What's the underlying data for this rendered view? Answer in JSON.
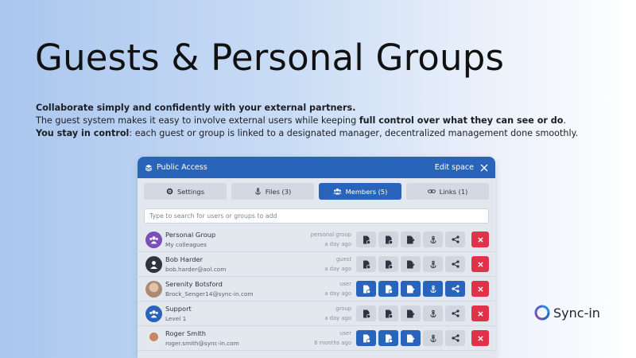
{
  "headline": "Guests & Personal Groups",
  "intro": {
    "line1": "Collaborate simply and confidently with your external partners.",
    "line2_a": "The guest system makes it easy to involve external users while keeping ",
    "line2_b": "full control over what they can see or do",
    "line2_c": ".",
    "line3_a": "You stay in control",
    "line3_b": ": each guest or group is linked to a designated manager, decentralized management done smoothly."
  },
  "panel": {
    "title": "Public Access",
    "edit_label": "Edit space",
    "tabs": [
      {
        "label": "Settings",
        "icon": "gear-icon"
      },
      {
        "label": "Files (3)",
        "icon": "anchor-icon"
      },
      {
        "label": "Members (5)",
        "icon": "users-icon",
        "active": true
      },
      {
        "label": "Links (1)",
        "icon": "link-icon"
      }
    ],
    "search_placeholder": "Type to search for users or groups to add",
    "members": [
      {
        "name": "Personal Group",
        "sub": "My colleagues",
        "type": "personal group",
        "time": "a day ago",
        "avatar": "group-avatar",
        "perms": [
          false,
          false,
          false,
          false,
          false
        ]
      },
      {
        "name": "Bob Harder",
        "sub": "bob.harder@aol.com",
        "type": "guest",
        "time": "a day ago",
        "avatar": "user-avatar",
        "perms": [
          false,
          false,
          false,
          false,
          false
        ]
      },
      {
        "name": "Serenity Botsford",
        "sub": "Brock_Senger14@sync-in.com",
        "type": "user",
        "time": "a day ago",
        "avatar": "photo-avatar",
        "perms": [
          true,
          true,
          true,
          true,
          true
        ]
      },
      {
        "name": "Support",
        "sub": "Level 1",
        "type": "group",
        "time": "a day ago",
        "avatar": "group-avatar",
        "perms": [
          false,
          false,
          false,
          false,
          false
        ]
      },
      {
        "name": "Roger Smith",
        "sub": "roger.smith@sync-in.com",
        "type": "user",
        "time": "8 months ago",
        "avatar": "photo-avatar",
        "perms": [
          true,
          true,
          true,
          false,
          false
        ]
      }
    ]
  },
  "brand": {
    "name": "Sync-in"
  },
  "colors": {
    "accent": "#2a64ba",
    "danger": "#e0334a",
    "logo_a": "#7c4fb8",
    "logo_b": "#2a8be0"
  }
}
